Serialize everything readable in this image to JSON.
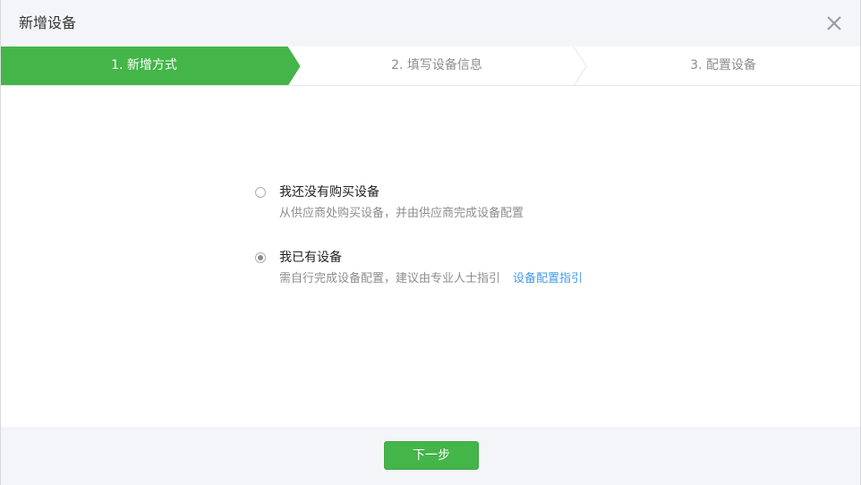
{
  "dialog": {
    "title": "新增设备"
  },
  "steps": [
    {
      "label": "1. 新增方式",
      "active": true
    },
    {
      "label": "2. 填写设备信息",
      "active": false
    },
    {
      "label": "3. 配置设备",
      "active": false
    }
  ],
  "options": [
    {
      "title": "我还没有购买设备",
      "description": "从供应商处购买设备，并由供应商完成设备配置",
      "checked": false
    },
    {
      "title": "我已有设备",
      "description": "需自行完成设备配置，建议由专业人士指引",
      "link": "设备配置指引",
      "checked": true
    }
  ],
  "footer": {
    "next_label": "下一步"
  },
  "colors": {
    "accent": "#44b549",
    "link": "#459ae9",
    "header_bg": "#f4f5f9"
  }
}
